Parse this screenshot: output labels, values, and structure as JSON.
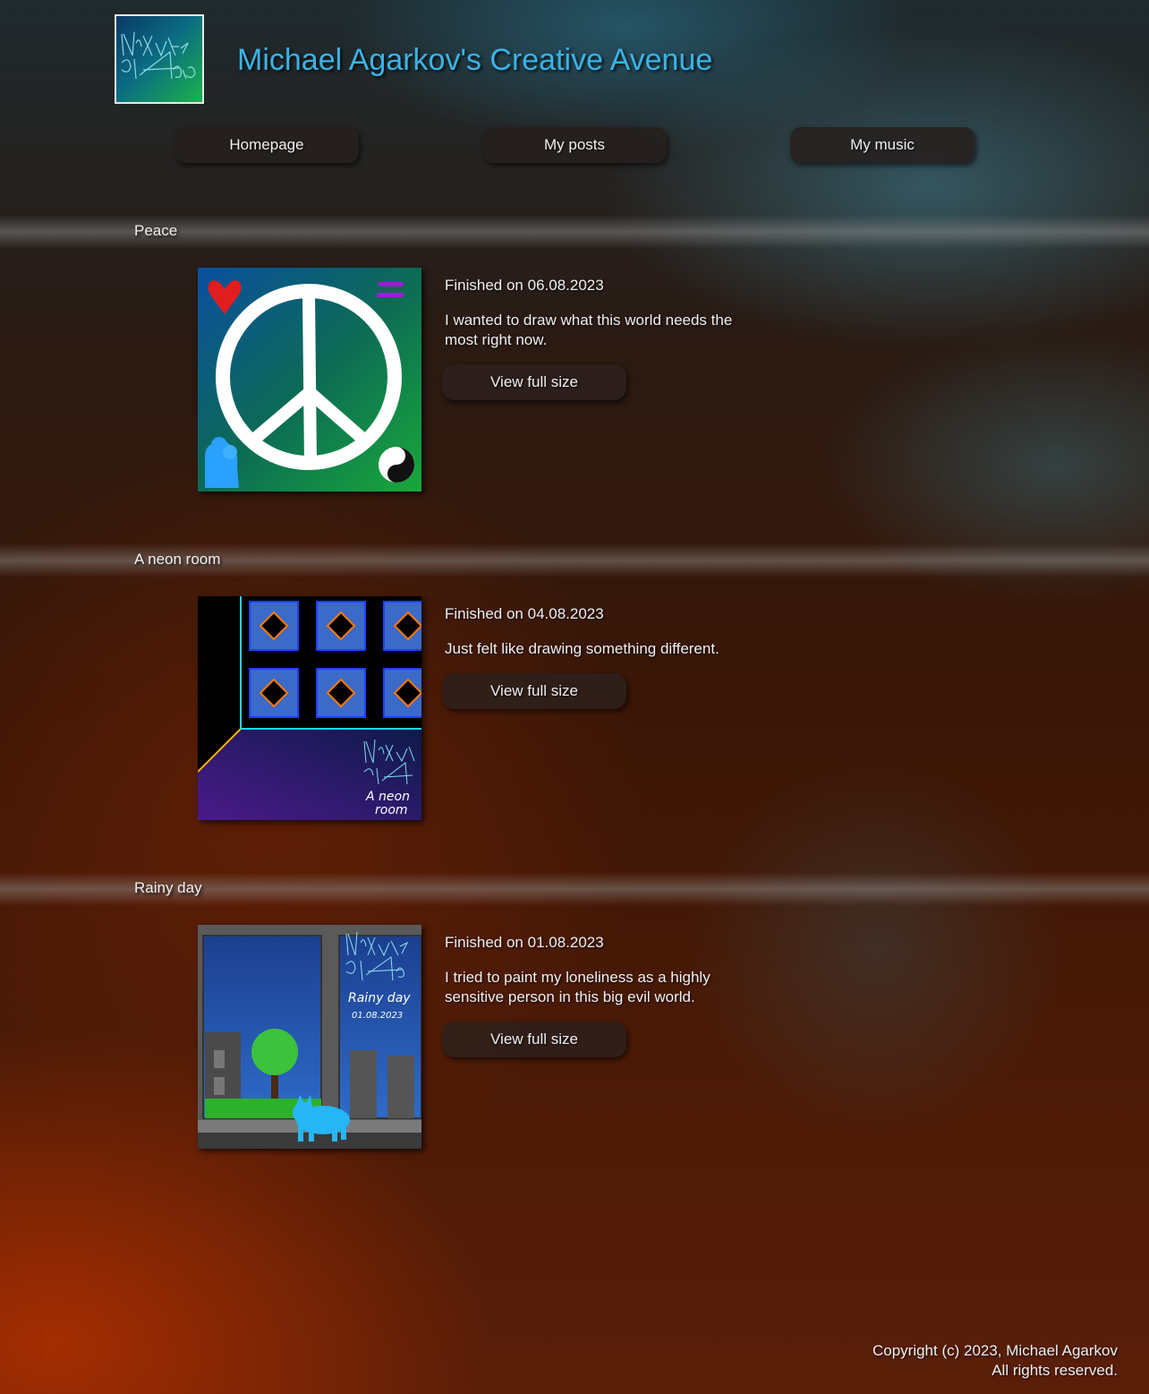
{
  "site": {
    "title": "Michael Agarkov's Creative Avenue"
  },
  "nav": [
    {
      "label": "Homepage"
    },
    {
      "label": "My posts"
    },
    {
      "label": "My music"
    }
  ],
  "posts": [
    {
      "title": "Peace",
      "date": "Finished on 06.08.2023",
      "description": "I wanted to draw what this world needs the most right now.",
      "button_label": "View full size"
    },
    {
      "title": "A neon room",
      "date": "Finished on 04.08.2023",
      "description": "Just felt like drawing something different.",
      "button_label": "View full size"
    },
    {
      "title": "Rainy day",
      "date": "Finished on 01.08.2023",
      "description": "I tried to paint my loneliness as a highly sensitive person in this big evil world.",
      "button_label": "View full size"
    }
  ],
  "footer": {
    "copyright": "Copyright (c) 2023, Michael Agarkov",
    "rights": "All rights reserved."
  },
  "colors": {
    "title_accent": "#3ab3e6",
    "button_bg": "#2d201c"
  }
}
